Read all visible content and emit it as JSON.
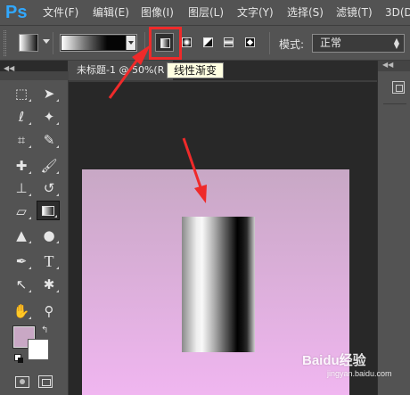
{
  "app": {
    "logo": "Ps",
    "accent": "#31a8ff"
  },
  "menu": {
    "items": [
      "文件(F)",
      "编辑(E)",
      "图像(I)",
      "图层(L)",
      "文字(Y)",
      "选择(S)",
      "滤镜(T)",
      "3D(D)"
    ]
  },
  "options": {
    "gradient_type_tooltip": "线性渐变",
    "mode_label": "模式:",
    "mode_value": "正常",
    "highlight_color": "#ef2a2a"
  },
  "document": {
    "tab_title": "未标题-1 @ 50%(R",
    "canvas_top_color": "#c8a8c5",
    "canvas_bottom_color": "#f0b6f0"
  },
  "tools": {
    "foreground_color": "#c9a8c5",
    "background_color": "#ffffff"
  },
  "watermark": {
    "text": "Baidu经验",
    "sub": "jingyan.baidu.com"
  }
}
